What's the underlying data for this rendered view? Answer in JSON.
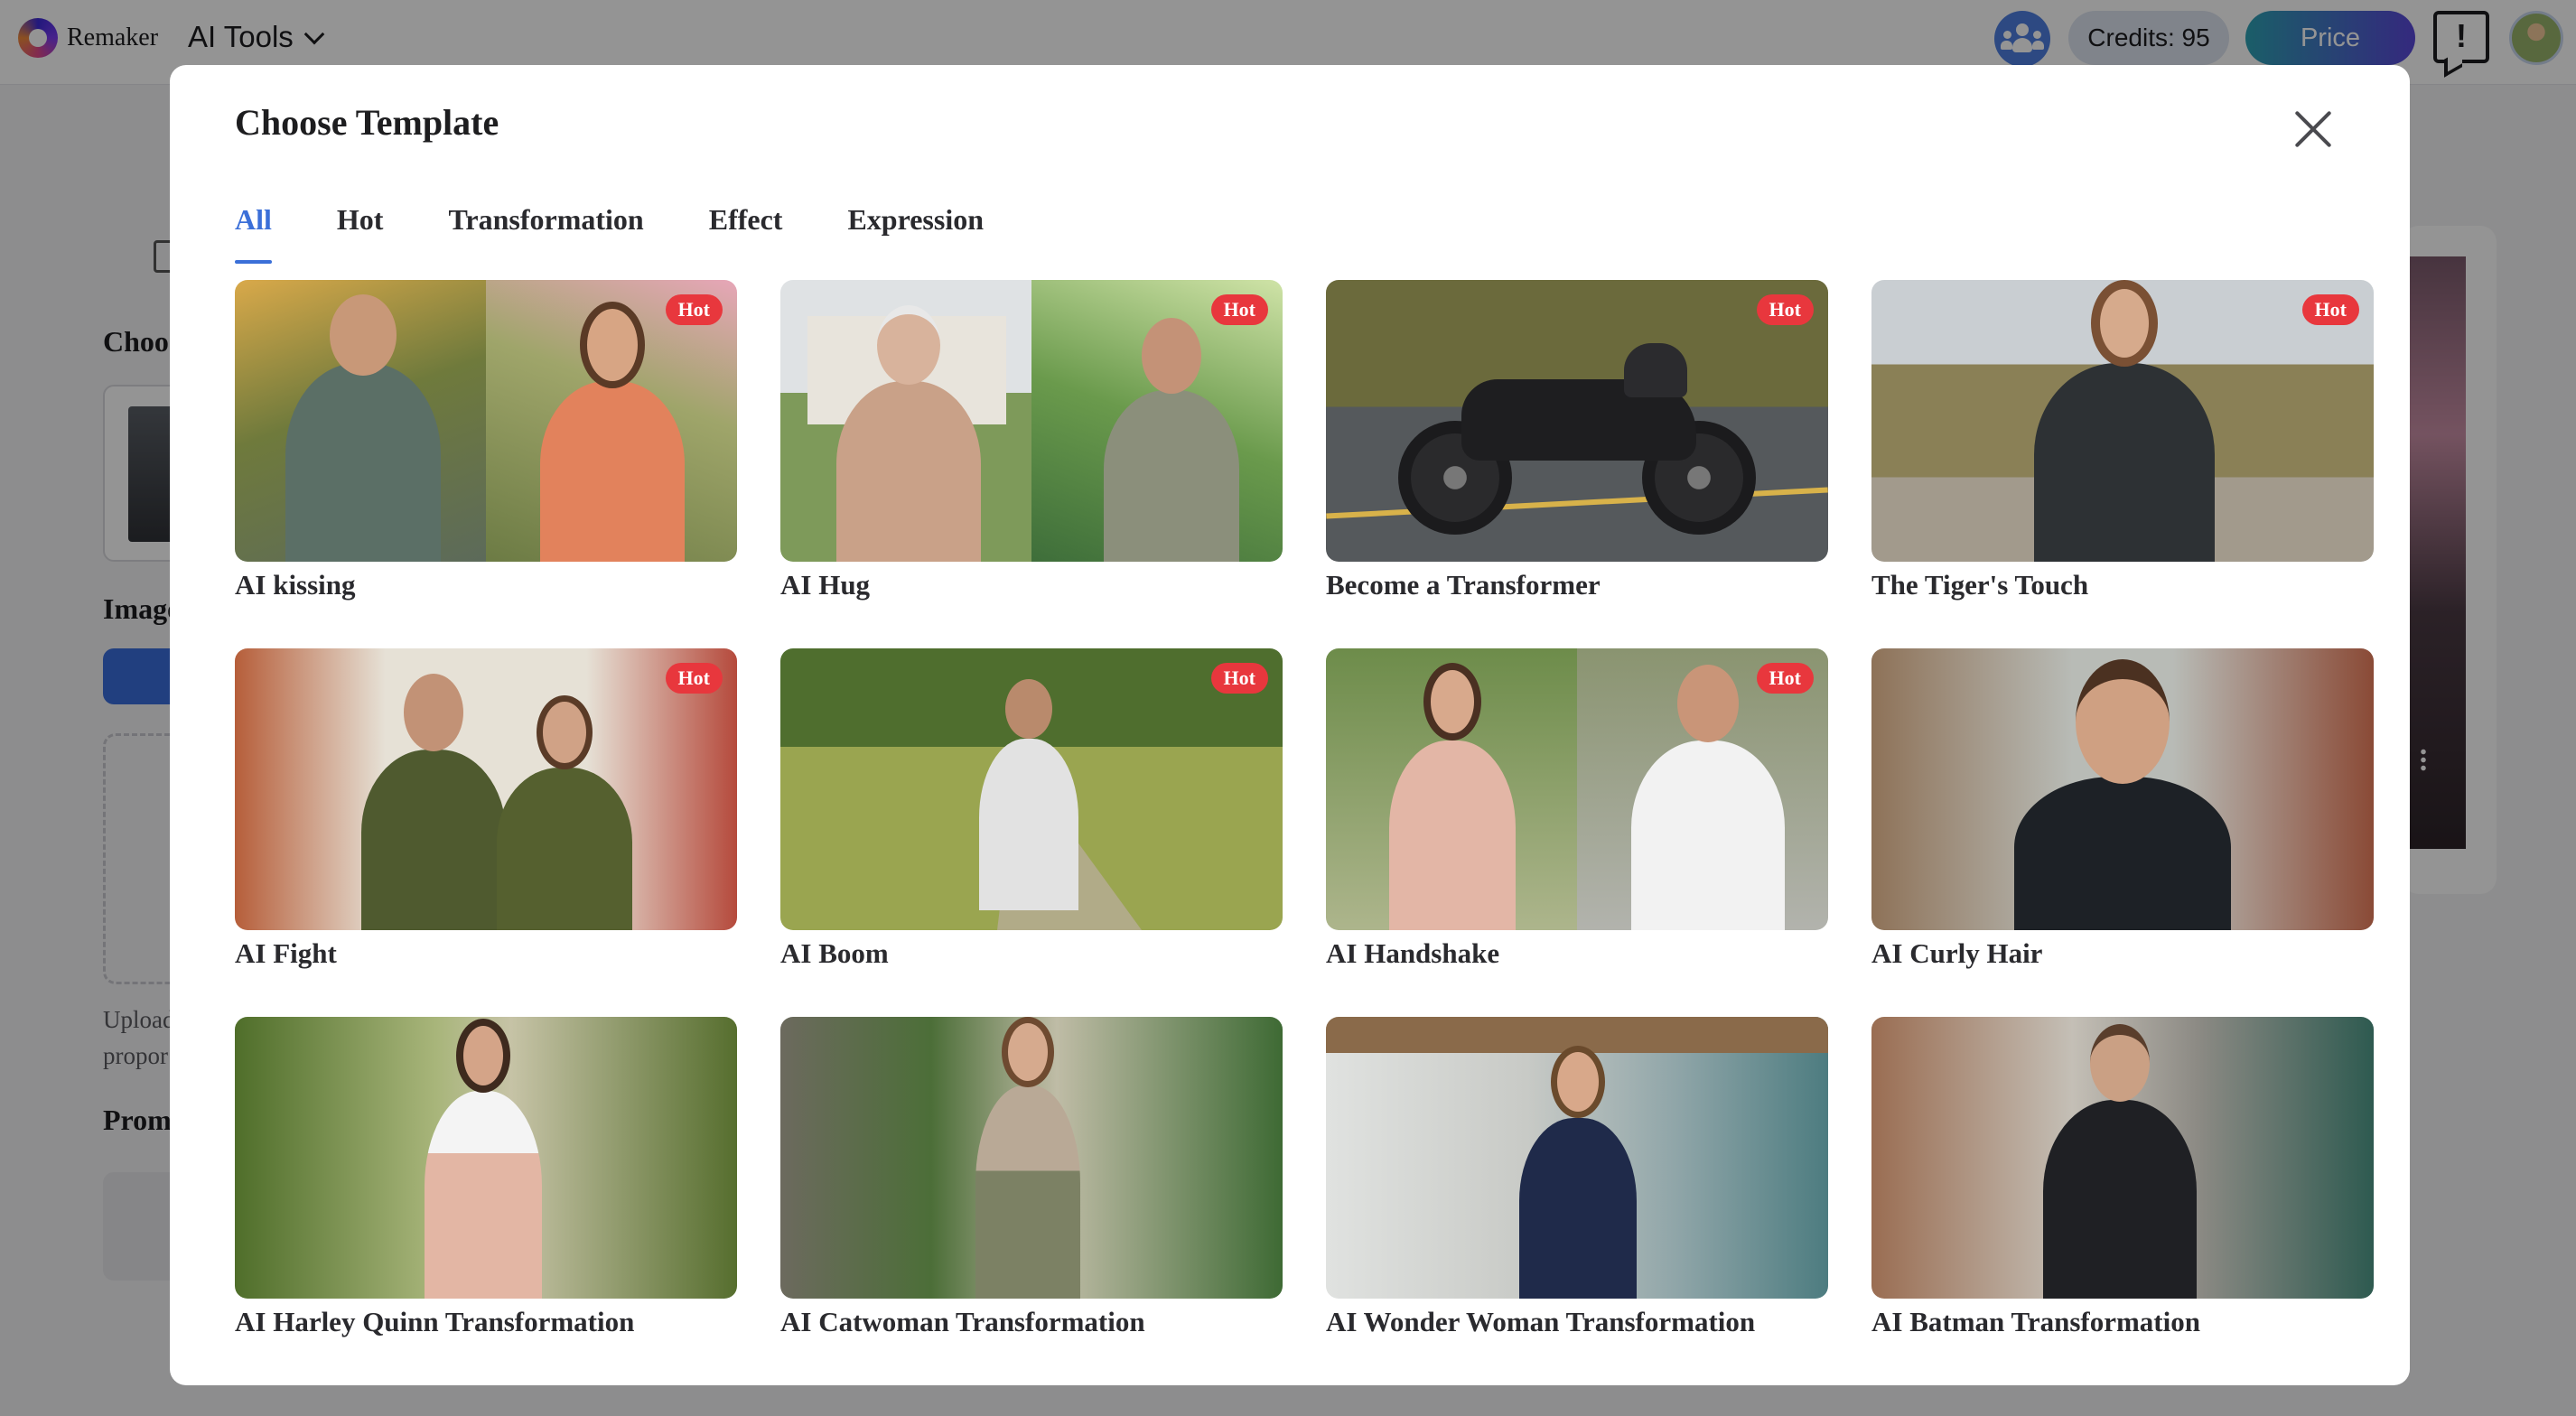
{
  "header": {
    "brand": "Remaker",
    "menu_label": "AI Tools",
    "credits": "Credits: 95",
    "price_label": "Price",
    "feedback_label": "!"
  },
  "background": {
    "choose_label": "Choo",
    "image_label": "Image",
    "upload_line1": "Upload",
    "upload_line2": "propor",
    "prompt_label": "Prom"
  },
  "modal": {
    "title": "Choose Template",
    "tabs": [
      {
        "label": "All",
        "active": true
      },
      {
        "label": "Hot",
        "active": false
      },
      {
        "label": "Transformation",
        "active": false
      },
      {
        "label": "Effect",
        "active": false
      },
      {
        "label": "Expression",
        "active": false
      }
    ],
    "badge": "Hot",
    "templates": [
      {
        "label": "AI kissing",
        "hot": true
      },
      {
        "label": "AI Hug",
        "hot": true
      },
      {
        "label": "Become a Transformer",
        "hot": true
      },
      {
        "label": "The Tiger's Touch",
        "hot": true
      },
      {
        "label": "AI Fight",
        "hot": true
      },
      {
        "label": "AI Boom",
        "hot": true
      },
      {
        "label": "AI Handshake",
        "hot": true
      },
      {
        "label": "AI Curly Hair",
        "hot": false
      },
      {
        "label": "AI Harley Quinn Transformation",
        "hot": false
      },
      {
        "label": "AI Catwoman Transformation",
        "hot": false
      },
      {
        "label": "AI Wonder Woman Transformation",
        "hot": false
      },
      {
        "label": "AI Batman Transformation",
        "hot": false
      }
    ]
  },
  "colors": {
    "accent": "#3b6fd8",
    "hot_badge": "#e8373d",
    "price_gradient_start": "#2ea2b4",
    "price_gradient_end": "#5a47d9"
  },
  "icons": {
    "logo": "remaker-logo-icon",
    "menu": "chevron-down-icon",
    "team": "team-icon",
    "feedback": "feedback-icon",
    "close": "close-icon"
  }
}
